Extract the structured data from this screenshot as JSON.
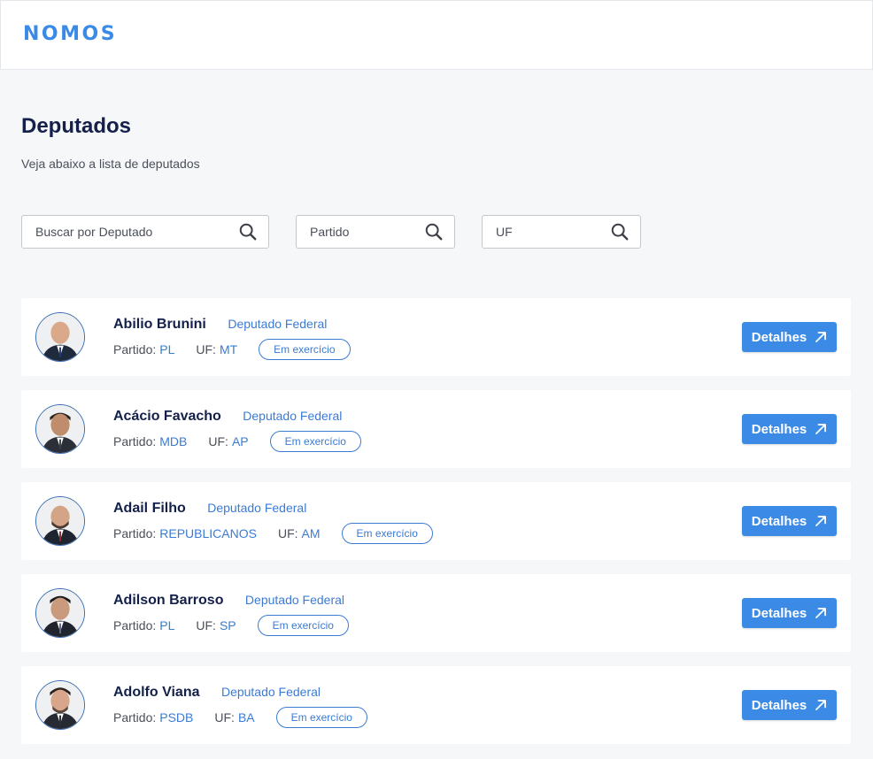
{
  "app": {
    "logo": "NOMOS",
    "accent_color": "#3b8be6"
  },
  "page": {
    "title": "Deputados",
    "subtitle": "Veja abaixo a lista de deputados"
  },
  "filters": {
    "deputado_placeholder": "Buscar por Deputado",
    "partido_placeholder": "Partido",
    "uf_placeholder": "UF",
    "icon": "search-icon"
  },
  "labels": {
    "partido": "Partido:",
    "uf": "UF:",
    "details_button": "Detalhes",
    "details_icon": "arrow-up-right-icon"
  },
  "deputados": [
    {
      "name": "Abilio Brunini",
      "role": "Deputado Federal",
      "partido": "PL",
      "uf": "MT",
      "status": "Em exercício"
    },
    {
      "name": "Acácio Favacho",
      "role": "Deputado Federal",
      "partido": "MDB",
      "uf": "AP",
      "status": "Em exercício"
    },
    {
      "name": "Adail Filho",
      "role": "Deputado Federal",
      "partido": "REPUBLICANOS",
      "uf": "AM",
      "status": "Em exercício"
    },
    {
      "name": "Adilson Barroso",
      "role": "Deputado Federal",
      "partido": "PL",
      "uf": "SP",
      "status": "Em exercício"
    },
    {
      "name": "Adolfo Viana",
      "role": "Deputado Federal",
      "partido": "PSDB",
      "uf": "BA",
      "status": "Em exercício"
    }
  ]
}
